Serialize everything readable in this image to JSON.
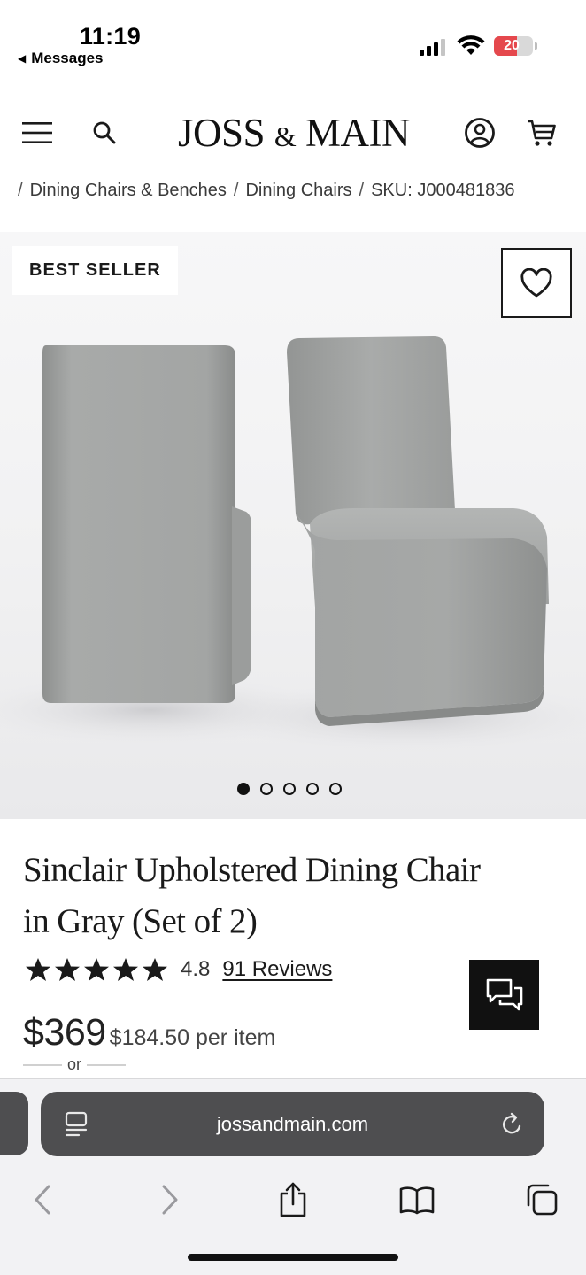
{
  "status_bar": {
    "time": "11:19",
    "back_app": "Messages",
    "battery_level": "20",
    "battery_color": "#e5484d"
  },
  "header": {
    "logo_left": "JOSS",
    "logo_amp": "&",
    "logo_right": "MAIN",
    "icons": [
      "menu-icon",
      "search-icon",
      "account-icon",
      "cart-icon"
    ]
  },
  "breadcrumb": {
    "separator": "/",
    "items": [
      "Dining Chairs & Benches",
      "Dining Chairs"
    ],
    "sku": "SKU: J000481836"
  },
  "hero": {
    "badge": "BEST SELLER",
    "image_count": 5,
    "active_index": 0
  },
  "product": {
    "title_line1": "Sinclair Upholstered Dining Chair",
    "title_line2": "in Gray (Set of 2)",
    "rating_value": "4.8",
    "stars": 5,
    "reviews_label": "91 Reviews",
    "price": "$369",
    "per_item": "$184.50 per item",
    "or_label": "or"
  },
  "browser": {
    "url": "jossandmain.com",
    "toolbar_icons": [
      "back-icon",
      "forward-icon",
      "share-icon",
      "bookmarks-icon",
      "tabs-icon"
    ]
  }
}
